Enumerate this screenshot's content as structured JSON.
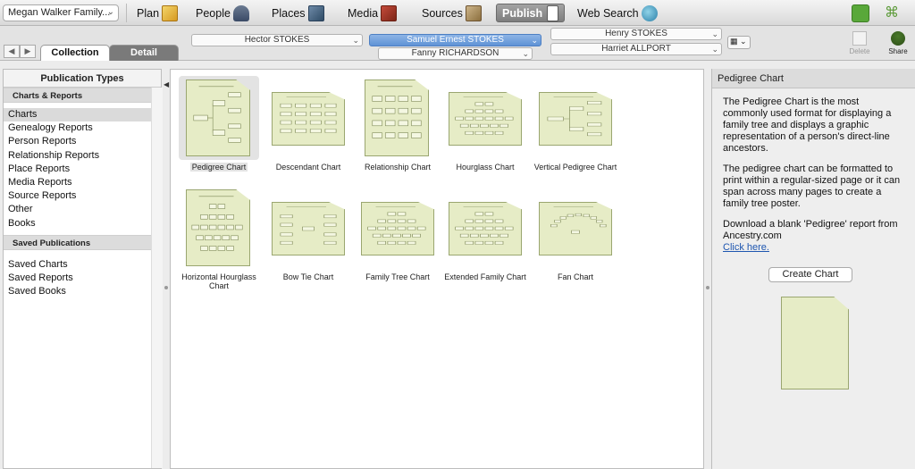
{
  "toolbar": {
    "tree_name": "Megan Walker Family...",
    "nav": [
      {
        "label": "Plan"
      },
      {
        "label": "People"
      },
      {
        "label": "Places"
      },
      {
        "label": "Media"
      },
      {
        "label": "Sources"
      },
      {
        "label": "Publish"
      },
      {
        "label": "Web Search"
      }
    ],
    "active": "Publish"
  },
  "secondbar": {
    "tabs": [
      "Collection",
      "Detail"
    ],
    "active_tab": "Collection",
    "persons": {
      "father": "Hector STOKES",
      "self": "Samuel Ernest STOKES",
      "mother": "Fanny RICHARDSON",
      "grandfather": "Henry STOKES",
      "grandmother": "Harriet ALLPORT"
    },
    "tools": {
      "delete": "Delete",
      "share": "Share"
    }
  },
  "left": {
    "header": "Publication Types",
    "groups": [
      {
        "title": "Charts & Reports",
        "items": [
          "Charts",
          "Genealogy Reports",
          "Person Reports",
          "Relationship Reports",
          "Place Reports",
          "Media Reports",
          "Source Reports",
          "Other",
          "Books"
        ]
      },
      {
        "title": "Saved Publications",
        "items": [
          "Saved Charts",
          "Saved Reports",
          "Saved Books"
        ]
      }
    ],
    "selected": "Charts"
  },
  "center": {
    "charts": [
      {
        "label": "Pedigree Chart",
        "kind": "pedigree"
      },
      {
        "label": "Descendant Chart",
        "kind": "descendant"
      },
      {
        "label": "Relationship Chart",
        "kind": "relationship"
      },
      {
        "label": "Hourglass Chart",
        "kind": "hourglass"
      },
      {
        "label": "Vertical Pedigree Chart",
        "kind": "vertical"
      },
      {
        "label": "Horizontal Hourglass Chart",
        "kind": "hhourglass"
      },
      {
        "label": "Bow Tie Chart",
        "kind": "bowtie"
      },
      {
        "label": "Family Tree Chart",
        "kind": "familytree"
      },
      {
        "label": "Extended Family Chart",
        "kind": "extended"
      },
      {
        "label": "Fan Chart",
        "kind": "fan"
      }
    ],
    "selected": "Pedigree Chart"
  },
  "right": {
    "title": "Pedigree Chart",
    "para1": "The Pedigree Chart is the most commonly used format for displaying a family tree and displays a graphic representation of a person's direct-line ancestors.",
    "para2": "The pedigree chart can be formatted to print within a regular-sized page or it can span across many pages to create a family tree poster.",
    "para3": "Download a blank 'Pedigree' report from Ancestry.com",
    "link": "Click here.",
    "button": "Create Chart"
  }
}
